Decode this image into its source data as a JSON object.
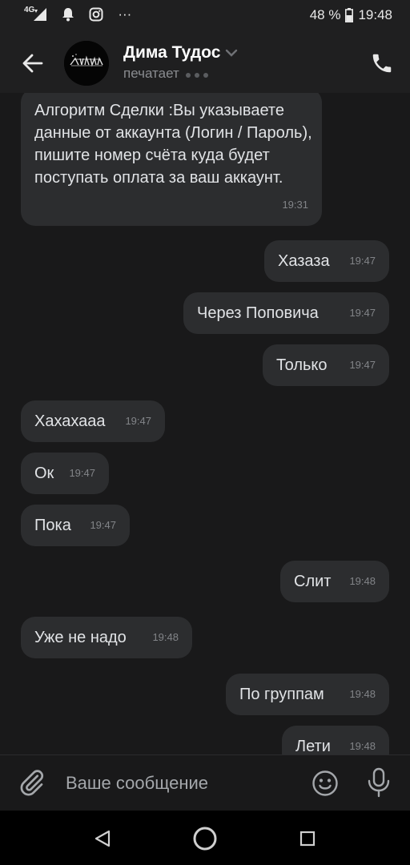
{
  "status_bar": {
    "network": "4G",
    "battery": "48 %",
    "time": "19:48",
    "more": "···"
  },
  "header": {
    "contact_name": "Дима Тудос",
    "contact_status": "печатает"
  },
  "messages": [
    {
      "dir": "in",
      "text": "Алгоритм Сделки :Вы указываете данные от аккаунта (Логин / Пароль), пишите номер счёта куда будет поступать оплата за ваш аккаунт.",
      "time": "19:31"
    },
    {
      "dir": "out",
      "text": "Хазаза",
      "time": "19:47"
    },
    {
      "dir": "out",
      "text": "Через Поповича",
      "time": "19:47"
    },
    {
      "dir": "out",
      "text": "Только",
      "time": "19:47"
    },
    {
      "dir": "in",
      "text": "Хахахааа",
      "time": "19:47"
    },
    {
      "dir": "in",
      "text": "Ок",
      "time": "19:47"
    },
    {
      "dir": "in",
      "text": "Пока",
      "time": "19:47"
    },
    {
      "dir": "out",
      "text": "Слит",
      "time": "19:48"
    },
    {
      "dir": "in",
      "text": "Уже не надо",
      "time": "19:48"
    },
    {
      "dir": "out",
      "text": "По группам",
      "time": "19:48"
    },
    {
      "dir": "out",
      "text": "Лети",
      "time": "19:48"
    }
  ],
  "composer": {
    "placeholder": "Ваше сообщение"
  },
  "icons": {
    "back": "arrow-left-icon",
    "call": "phone-icon",
    "attach": "paperclip-icon",
    "emoji": "emoji-icon",
    "mic": "microphone-icon"
  },
  "colors": {
    "background": "#19191a",
    "bubble": "#2c2d2f",
    "header": "#1f1f20"
  }
}
